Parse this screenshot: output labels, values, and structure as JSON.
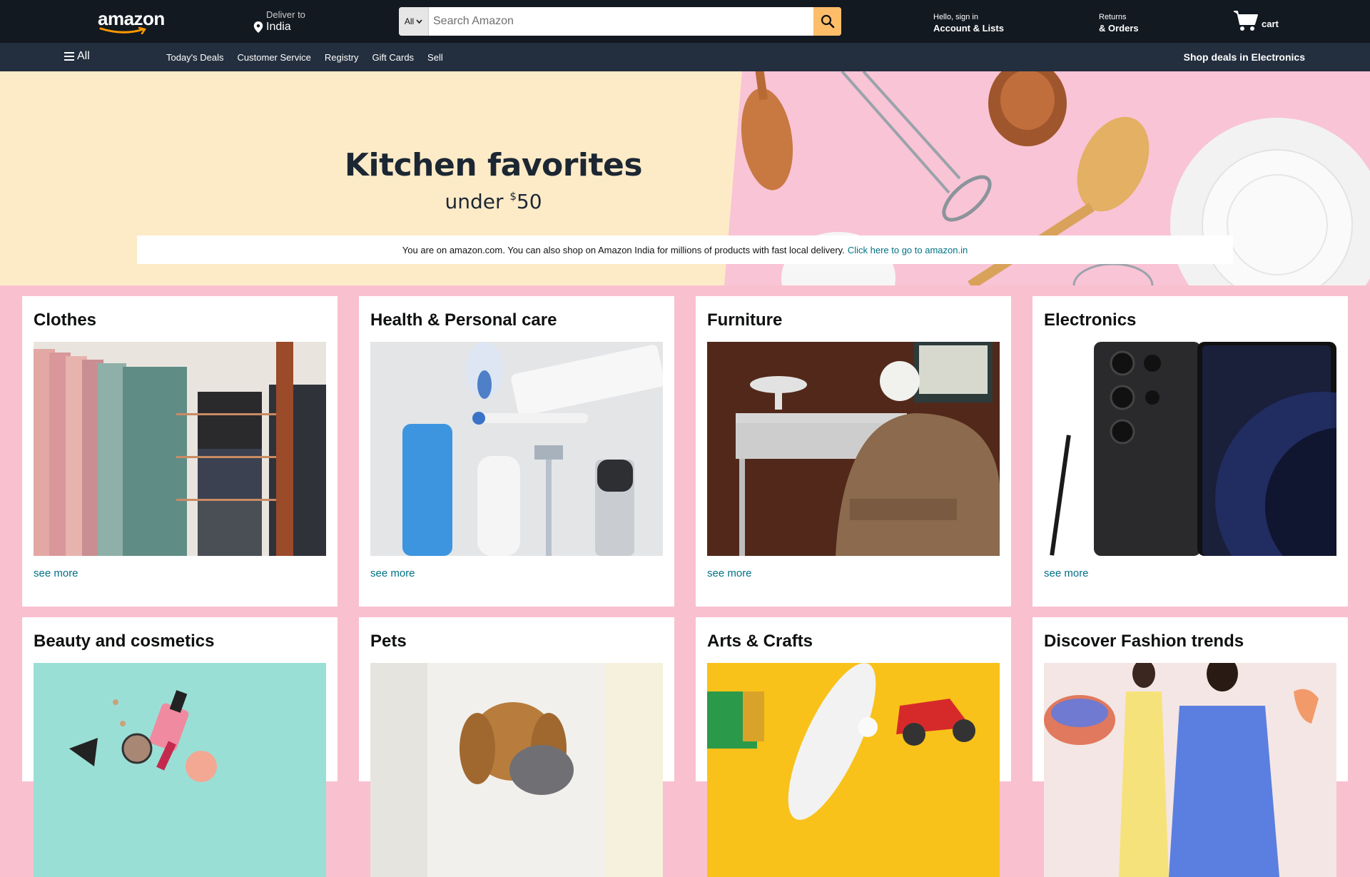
{
  "header": {
    "logo_text": "amazon",
    "deliver_label": "Deliver to",
    "deliver_location": "India",
    "search": {
      "category": "All",
      "placeholder": "Search Amazon"
    },
    "account_greeting": "Hello, sign in",
    "account_label": "Account & Lists",
    "returns_label": "Returns",
    "orders_label": "& Orders",
    "cart_label": "cart"
  },
  "subnav": {
    "all_label": "All",
    "links": [
      "Today's Deals",
      "Customer Service",
      "Registry",
      "Gift Cards",
      "Sell"
    ],
    "promo": "Shop deals in Electronics"
  },
  "hero": {
    "title": "Kitchen favorites",
    "subtitle_prefix": "under ",
    "subtitle_currency": "$",
    "subtitle_amount": "50",
    "notice_text": "You are on amazon.com. You can also shop on Amazon India for millions of products with fast local delivery.",
    "notice_link": "Click here to go to amazon.in"
  },
  "cards": [
    {
      "title": "Clothes",
      "link": "see more"
    },
    {
      "title": "Health & Personal care",
      "link": "see more"
    },
    {
      "title": "Furniture",
      "link": "see more"
    },
    {
      "title": "Electronics",
      "link": "see more"
    },
    {
      "title": "Beauty and cosmetics"
    },
    {
      "title": "Pets"
    },
    {
      "title": "Arts & Crafts"
    },
    {
      "title": "Discover Fashion trends"
    }
  ],
  "colors": {
    "nav_bg": "#131921",
    "subnav_bg": "#232f3e",
    "search_button": "#febd69",
    "link": "#007185",
    "page_bg": "#f9c0d0"
  }
}
